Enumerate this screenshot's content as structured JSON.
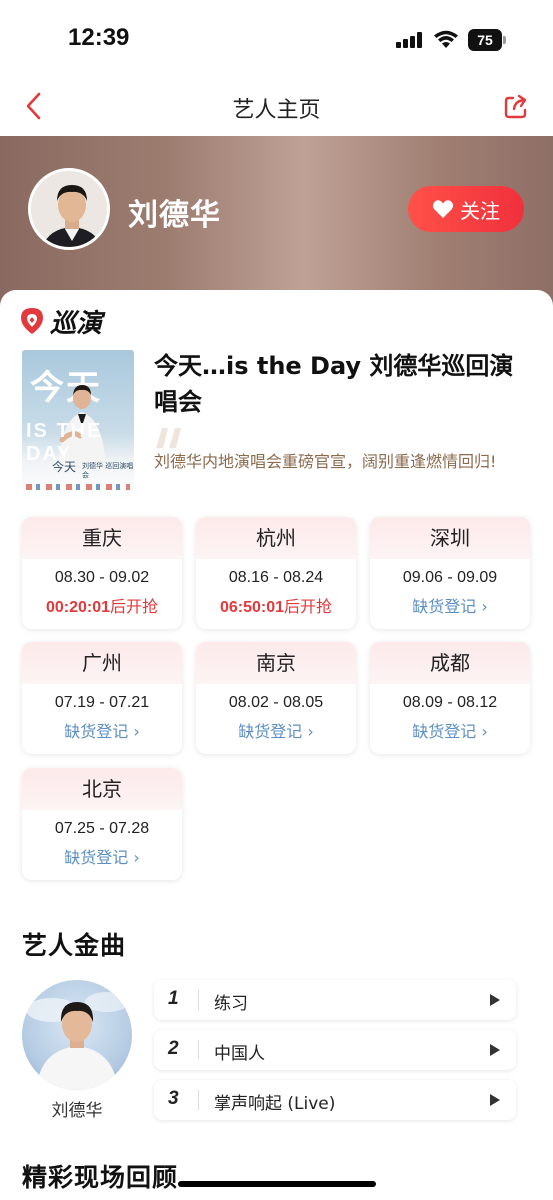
{
  "status_bar": {
    "time": "12:39",
    "battery": "75"
  },
  "nav": {
    "title": "艺人主页",
    "back_icon": "chevron-left-icon",
    "share_icon": "share-icon",
    "accent_color": "#e4393c"
  },
  "artist": {
    "name": "刘德华",
    "follow_label": "关注"
  },
  "tour": {
    "logo_text": "巡演",
    "poster": {
      "big_text": "今天",
      "overlay_text": "IS THE DAY",
      "small_title": "今天",
      "small_sub": "刘德华\n巡回演唱会"
    },
    "title": "今天…is the Day 刘德华巡回演唱会",
    "description": "刘德华内地演唱会重磅官宣，阔别重逢燃情回归!",
    "cities": [
      {
        "city": "重庆",
        "dates": "08.30 - 09.02",
        "countdown": "00:20:01",
        "suffix": "后开抢",
        "status_type": "countdown"
      },
      {
        "city": "杭州",
        "dates": "08.16 - 08.24",
        "countdown": "06:50:01",
        "suffix": "后开抢",
        "status_type": "countdown"
      },
      {
        "city": "深圳",
        "dates": "09.06 - 09.09",
        "status": "缺货登记 ›",
        "status_type": "notify"
      },
      {
        "city": "广州",
        "dates": "07.19 - 07.21",
        "status": "缺货登记 ›",
        "status_type": "notify"
      },
      {
        "city": "南京",
        "dates": "08.02 - 08.05",
        "status": "缺货登记 ›",
        "status_type": "notify"
      },
      {
        "city": "成都",
        "dates": "08.09 - 08.12",
        "status": "缺货登记 ›",
        "status_type": "notify"
      },
      {
        "city": "北京",
        "dates": "07.25 - 07.28",
        "status": "缺货登记 ›",
        "status_type": "notify"
      }
    ]
  },
  "songs_section": {
    "title": "艺人金曲",
    "artist_name": "刘德华",
    "songs": [
      {
        "rank": "1",
        "name": "练习"
      },
      {
        "rank": "2",
        "name": "中国人"
      },
      {
        "rank": "3",
        "name": "掌声响起 (Live)"
      }
    ]
  },
  "replay_section": {
    "title": "精彩现场回顾"
  }
}
